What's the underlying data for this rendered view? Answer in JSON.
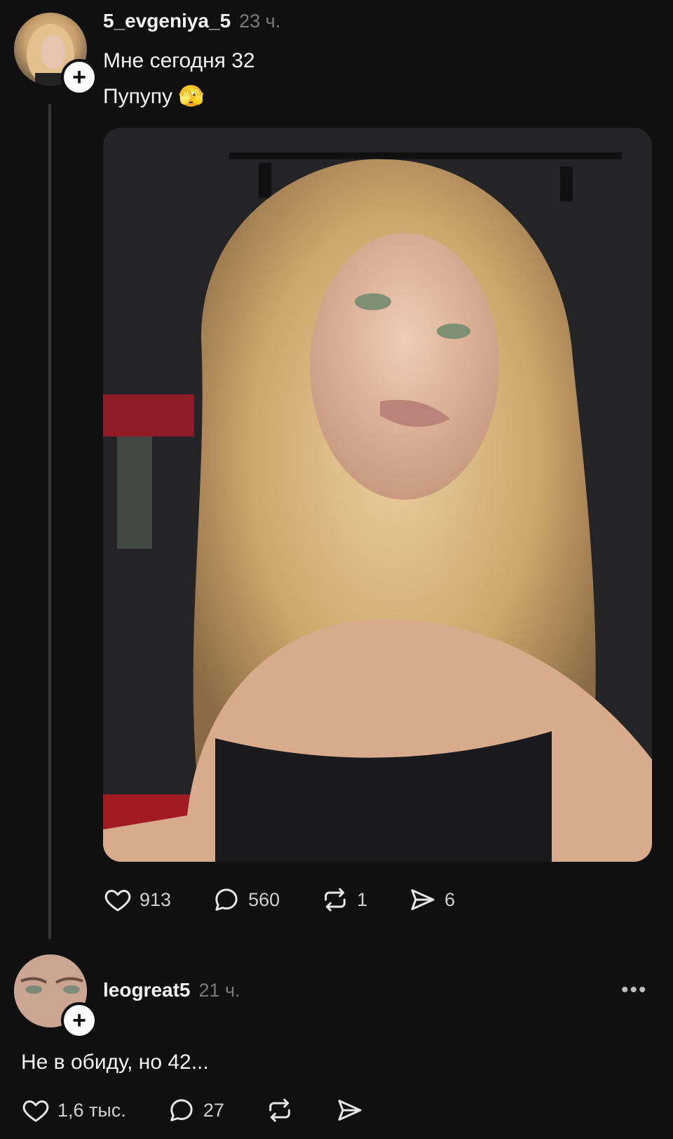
{
  "post": {
    "username": "5_evgeniya_5",
    "time": "23 ч.",
    "lines": [
      "Мне сегодня 32",
      "Пупупу 🫣"
    ],
    "image_alt": "selfie photo",
    "actions": {
      "likes": "913",
      "comments": "560",
      "reposts": "1",
      "shares": "6"
    }
  },
  "reply": {
    "username": "leogreat5",
    "time": "21 ч.",
    "text": "Не в обиду,  но 42...",
    "actions": {
      "likes": "1,6 тыс.",
      "comments": "27"
    },
    "more_label": "•••"
  },
  "icons": {
    "follow": "plus-icon",
    "like": "heart-icon",
    "comment": "comment-bubble-icon",
    "repost": "repost-icon",
    "share": "send-icon",
    "more": "more-dots-icon"
  },
  "colors": {
    "background": "#101010",
    "text": "#f3f3f3",
    "muted": "#7a7a7a"
  }
}
